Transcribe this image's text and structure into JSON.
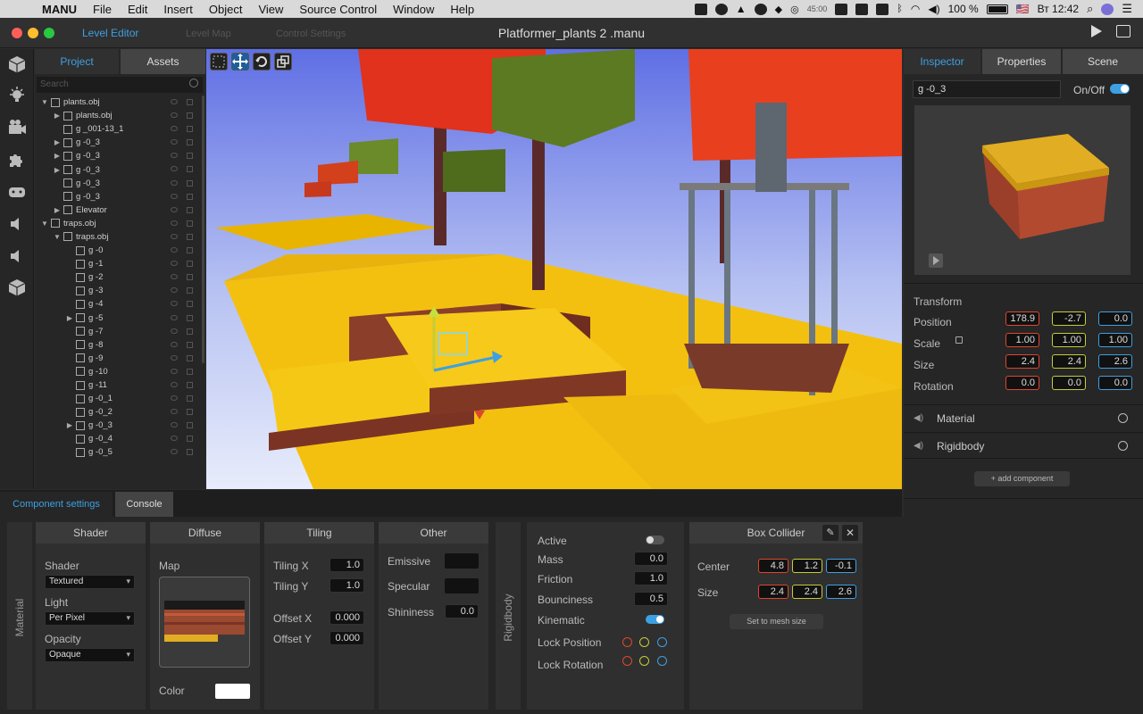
{
  "menubar": {
    "app": "MANU",
    "items": [
      "File",
      "Edit",
      "Insert",
      "Object",
      "View",
      "Source Control",
      "Window",
      "Help"
    ],
    "battery": "100 %",
    "flag": "🇺🇸",
    "clock": "Вт 12:42",
    "timer": "45:00"
  },
  "window": {
    "title": "Platformer_plants 2 .manu",
    "tabs": [
      "Level Editor",
      "Level Map",
      "Control Settings"
    ]
  },
  "hierarchy": {
    "tabs": [
      "Project",
      "Assets"
    ],
    "search_placeholder": "Search",
    "tree": [
      {
        "label": "plants.obj",
        "indent": 0,
        "arrow": "▼"
      },
      {
        "label": "plants.obj",
        "indent": 1,
        "arrow": "▶"
      },
      {
        "label": "g _001-13_1",
        "indent": 1,
        "arrow": ""
      },
      {
        "label": "g -0_3",
        "indent": 1,
        "arrow": "▶"
      },
      {
        "label": "g -0_3",
        "indent": 1,
        "arrow": "▶"
      },
      {
        "label": "g -0_3",
        "indent": 1,
        "arrow": "▶"
      },
      {
        "label": "g -0_3",
        "indent": 1,
        "arrow": ""
      },
      {
        "label": "g -0_3",
        "indent": 1,
        "arrow": ""
      },
      {
        "label": "Elevator",
        "indent": 1,
        "arrow": "▶"
      },
      {
        "label": "traps.obj",
        "indent": 0,
        "arrow": "▼"
      },
      {
        "label": "traps.obj",
        "indent": 1,
        "arrow": "▼"
      },
      {
        "label": "g -0",
        "indent": 2,
        "arrow": ""
      },
      {
        "label": "g -1",
        "indent": 2,
        "arrow": ""
      },
      {
        "label": "g -2",
        "indent": 2,
        "arrow": ""
      },
      {
        "label": "g -3",
        "indent": 2,
        "arrow": ""
      },
      {
        "label": "g -4",
        "indent": 2,
        "arrow": ""
      },
      {
        "label": "g -5",
        "indent": 2,
        "arrow": "▶"
      },
      {
        "label": "g -7",
        "indent": 2,
        "arrow": ""
      },
      {
        "label": "g -8",
        "indent": 2,
        "arrow": ""
      },
      {
        "label": "g -9",
        "indent": 2,
        "arrow": ""
      },
      {
        "label": "g -10",
        "indent": 2,
        "arrow": ""
      },
      {
        "label": "g -11",
        "indent": 2,
        "arrow": ""
      },
      {
        "label": "g -0_1",
        "indent": 2,
        "arrow": ""
      },
      {
        "label": "g -0_2",
        "indent": 2,
        "arrow": ""
      },
      {
        "label": "g -0_3",
        "indent": 2,
        "arrow": "▶"
      },
      {
        "label": "g -0_4",
        "indent": 2,
        "arrow": ""
      },
      {
        "label": "g -0_5",
        "indent": 2,
        "arrow": ""
      }
    ]
  },
  "inspector": {
    "tabs": [
      "Inspector",
      "Properties",
      "Scene"
    ],
    "object_name": "g -0_3",
    "onoff_label": "On/Off",
    "transform": {
      "title": "Transform",
      "position_label": "Position",
      "position": [
        "178.9",
        "-2.7",
        "0.0"
      ],
      "scale_label": "Scale",
      "scale": [
        "1.00",
        "1.00",
        "1.00"
      ],
      "size_label": "Size",
      "size": [
        "2.4",
        "2.4",
        "2.6"
      ],
      "rotation_label": "Rotation",
      "rotation": [
        "0.0",
        "0.0",
        "0.0"
      ]
    },
    "components": [
      "Material",
      "Rigidbody"
    ],
    "add_component": "+ add component"
  },
  "bottom": {
    "tabs": [
      "Component settings",
      "Console"
    ],
    "material_label": "Material",
    "shader": {
      "title": "Shader",
      "shader_label": "Shader",
      "shader_value": "Textured",
      "light_label": "Light",
      "light_value": "Per Pixel",
      "opacity_label": "Opacity",
      "opacity_value": "Opaque"
    },
    "diffuse": {
      "title": "Diffuse",
      "map_label": "Map",
      "color_label": "Color"
    },
    "tiling": {
      "title": "Tiling",
      "tiling_x_label": "Tiling X",
      "tiling_x": "1.0",
      "tiling_y_label": "Tiling Y",
      "tiling_y": "1.0",
      "offset_x_label": "Offset X",
      "offset_x": "0.000",
      "offset_y_label": "Offset Y",
      "offset_y": "0.000"
    },
    "other": {
      "title": "Other",
      "emissive_label": "Emissive",
      "specular_label": "Specular",
      "shininess_label": "Shininess",
      "shininess": "0.0"
    },
    "rigidbody": {
      "label": "Rigidbody",
      "active_label": "Active",
      "mass_label": "Mass",
      "mass": "0.0",
      "friction_label": "Friction",
      "friction": "1.0",
      "bounciness_label": "Bounciness",
      "bounciness": "0.5",
      "kinematic_label": "Kinematic",
      "lock_position_label": "Lock Position",
      "lock_rotation_label": "Lock Rotation"
    },
    "box_collider": {
      "title": "Box Collider",
      "center_label": "Center",
      "center": [
        "4.8",
        "1.2",
        "-0.1"
      ],
      "size_label": "Size",
      "size": [
        "2.4",
        "2.4",
        "2.6"
      ],
      "set_mesh_button": "Set to mesh size"
    }
  },
  "colors": {
    "accent": "#3da0e3",
    "x_axis": "#e0462c",
    "y_axis": "#c6cc36",
    "z_axis": "#3da0e3"
  }
}
